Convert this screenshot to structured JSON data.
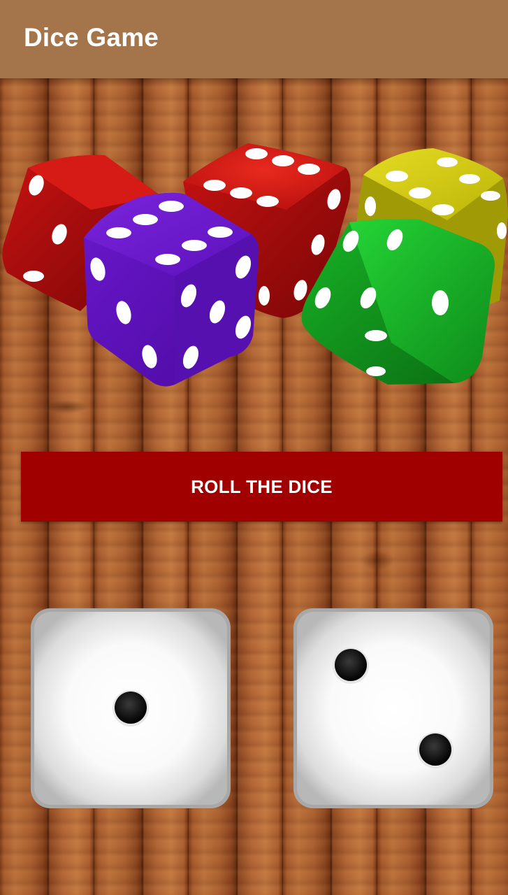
{
  "app_bar": {
    "title": "Dice Game"
  },
  "roll_button": {
    "label": "ROLL THE DICE"
  },
  "colors": {
    "app_bar": "#a4744a",
    "button": "#a00000",
    "wood": "#a65a2c"
  },
  "banner": {
    "icon": "colorful-dice-banner-image",
    "dice_colors": [
      "#d41414",
      "#6a14c8",
      "#d41414",
      "#d4cc10",
      "#18c428"
    ]
  },
  "dice": [
    {
      "name": "left-die",
      "value": 1
    },
    {
      "name": "right-die",
      "value": 2
    }
  ]
}
